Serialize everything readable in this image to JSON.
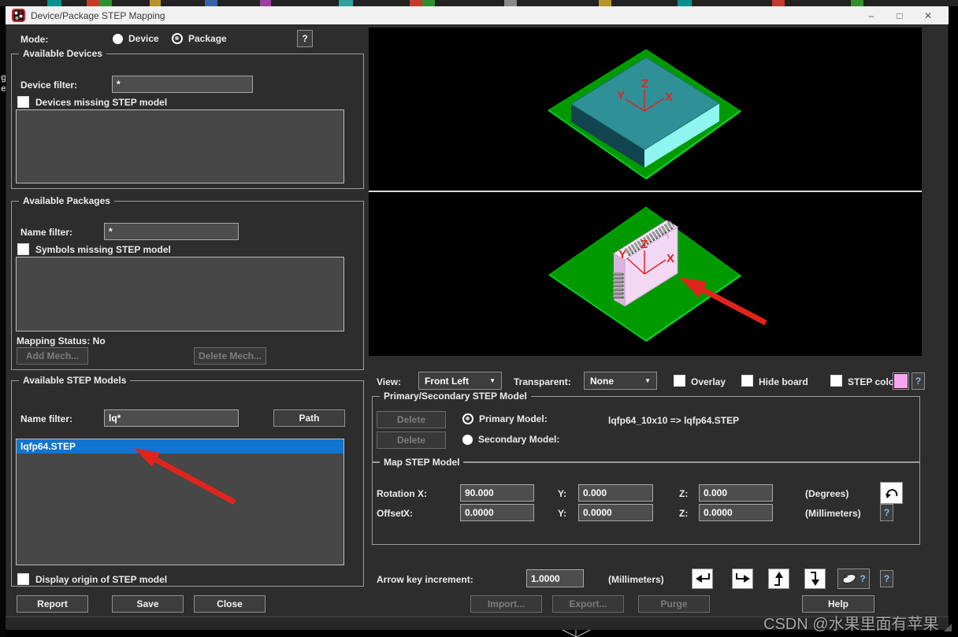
{
  "colors": {
    "accent_selection": "#1074d1",
    "annotation_red": "#e0241c",
    "swatch_pink": "#f8a5ef",
    "board_green": "#009a00",
    "board_edge": "#00e12e",
    "chip_top": "#2f9097",
    "chip_left": "#124450",
    "chip_right": "#8ef5f0",
    "model_pink": "#f3d8f6",
    "model_pink_dark": "#d9b3dd",
    "model_pink_light": "#fbeefc",
    "pin_gray": "#9b9b9b"
  },
  "background": {
    "edge_letters": [
      "g",
      "e"
    ]
  },
  "window": {
    "title": "Device/Package STEP Mapping",
    "minimize": "–",
    "maximize": "□",
    "close": "✕"
  },
  "icons": {
    "chevron": "▼"
  },
  "mode": {
    "label": "Mode:",
    "device_label": "Device",
    "package_label": "Package",
    "selected_option": "Package",
    "help": "?"
  },
  "available_devices": {
    "title": "Available Devices",
    "filter_label": "Device filter:",
    "filter_value": "*",
    "missing_checkbox_label": "Devices missing STEP model",
    "missing_checked": false,
    "items": []
  },
  "available_packages": {
    "title": "Available Packages",
    "filter_label": "Name filter:",
    "filter_value": "*",
    "missing_checkbox_label": "Symbols missing STEP model",
    "missing_checked": false,
    "items": [],
    "mapping_status": "Mapping Status: No",
    "add_mech_label": "Add Mech...",
    "delete_mech_label": "Delete Mech..."
  },
  "available_step_models": {
    "title": "Available STEP Models",
    "filter_label": "Name filter:",
    "filter_value": "lq*",
    "path_label": "Path",
    "items": [
      {
        "name": "lqfp64.STEP",
        "selected": true
      }
    ],
    "origin_checkbox_label": "Display origin of STEP model",
    "origin_checked": false
  },
  "footer_left": {
    "report_label": "Report",
    "save_label": "Save",
    "close_label": "Close"
  },
  "view_bar": {
    "view_label": "View:",
    "view_value": "Front Left",
    "transparent_label": "Transparent:",
    "transparent_value": "None",
    "overlay_label": "Overlay",
    "overlay_checked": false,
    "hide_board_label": "Hide board",
    "hide_board_checked": false,
    "step_color_label": "STEP color",
    "step_color_checked": false,
    "step_color_value": "#f8a5ef",
    "swatch_style": "background-color:#f8a5ef",
    "help": "?"
  },
  "primary_secondary": {
    "title": "Primary/Secondary STEP Model",
    "delete_primary_label": "Delete",
    "delete_secondary_label": "Delete",
    "primary_label": "Primary Model:",
    "primary_value": "lqfp64_10x10 => lqfp64.STEP",
    "secondary_label": "Secondary Model:",
    "secondary_value": "",
    "selected_option": "Primary Model"
  },
  "map_step_model": {
    "title": "Map STEP Model",
    "rotation_label": "Rotation X:",
    "y_label": "Y:",
    "z_label": "Z:",
    "rotation_x": "90.000",
    "rotation_y": "0.000",
    "rotation_z": "0.000",
    "degrees_label": "(Degrees)",
    "offset_label": "Offset",
    "offset_x_label": "X:",
    "offset_x": "0.0000",
    "offset_y": "0.0000",
    "offset_z": "0.0000",
    "millimeters_label": "(Millimeters)",
    "help": "?"
  },
  "increment_row": {
    "label": "Arrow key increment:",
    "value": "1.0000",
    "units_label": "(Millimeters)",
    "mouse_help": "?",
    "help": "?"
  },
  "footer_right": {
    "import_label": "Import...",
    "export_label": "Export...",
    "purge_label": "Purge",
    "help_label": "Help"
  },
  "viewports": {
    "axis": {
      "x": "X",
      "y": "Y",
      "z": "Z"
    }
  },
  "watermark": "CSDN @水果里面有苹果"
}
